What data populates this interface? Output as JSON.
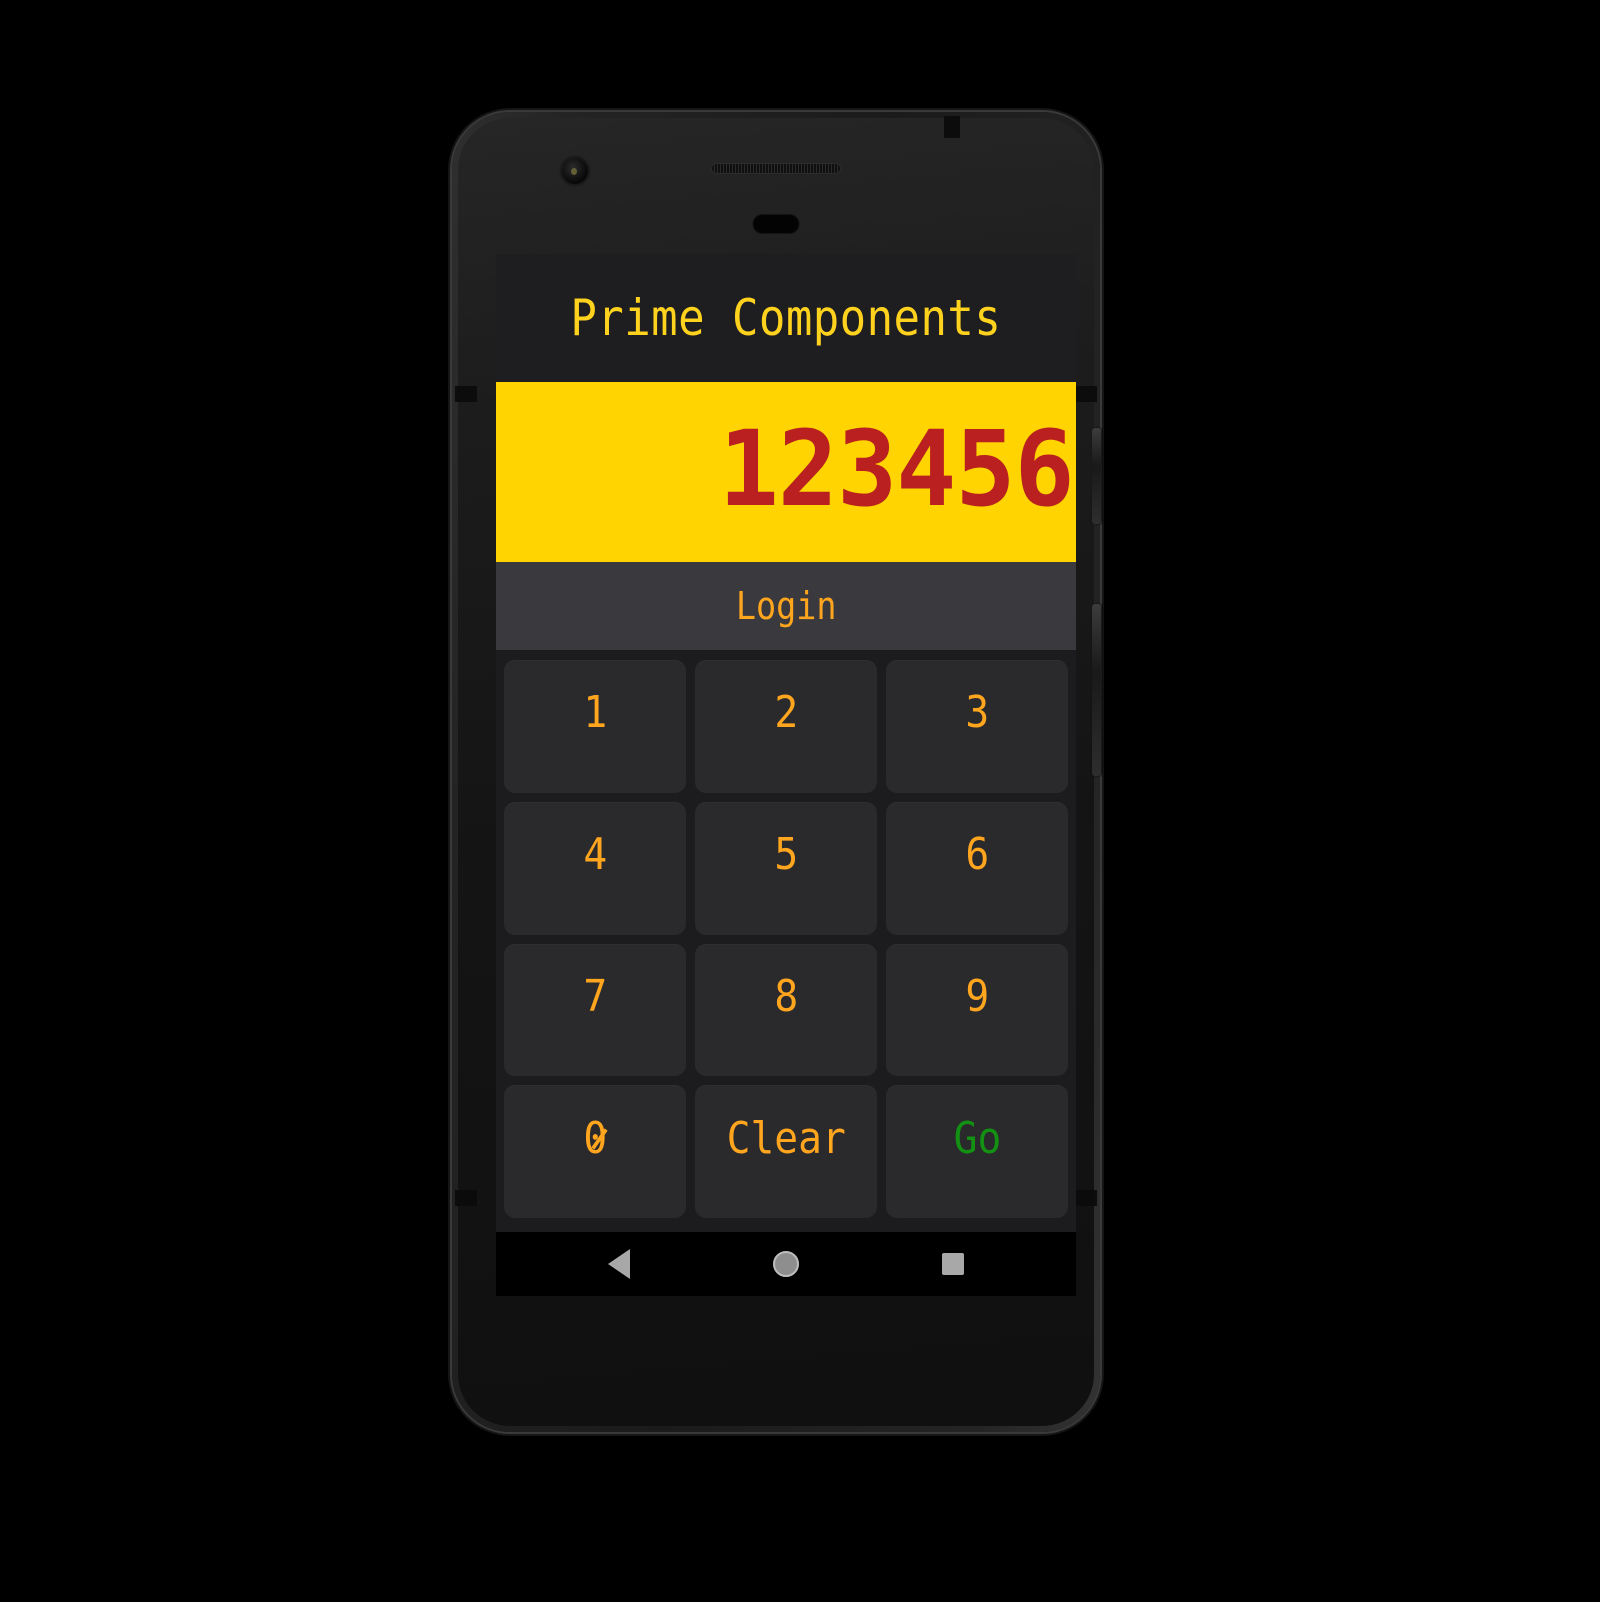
{
  "app": {
    "title": "Prime Components",
    "display_value": "123456",
    "login_label": "Login"
  },
  "keypad": {
    "keys": [
      {
        "label": "1",
        "name": "key-1",
        "kind": "digit"
      },
      {
        "label": "2",
        "name": "key-2",
        "kind": "digit"
      },
      {
        "label": "3",
        "name": "key-3",
        "kind": "digit"
      },
      {
        "label": "4",
        "name": "key-4",
        "kind": "digit"
      },
      {
        "label": "5",
        "name": "key-5",
        "kind": "digit"
      },
      {
        "label": "6",
        "name": "key-6",
        "kind": "digit"
      },
      {
        "label": "7",
        "name": "key-7",
        "kind": "digit"
      },
      {
        "label": "8",
        "name": "key-8",
        "kind": "digit"
      },
      {
        "label": "9",
        "name": "key-9",
        "kind": "digit"
      },
      {
        "label": "0",
        "name": "key-0",
        "kind": "digit-zero"
      },
      {
        "label": "Clear",
        "name": "key-clear",
        "kind": "action"
      },
      {
        "label": "Go",
        "name": "key-go",
        "kind": "action-go"
      }
    ]
  },
  "navbar": {
    "back_icon": "back-triangle-icon",
    "home_icon": "home-circle-icon",
    "recents_icon": "recents-square-icon"
  },
  "device": {
    "camera_icon": "front-camera-icon",
    "earpiece_icon": "earpiece-speaker-icon",
    "sensor_icon": "proximity-sensor-icon",
    "power_key": "power-button",
    "volume_key": "volume-rocker"
  },
  "colors": {
    "accent_yellow": "#ffd21e",
    "display_bg": "#ffd400",
    "display_text": "#b9201f",
    "key_text": "#ffa51e",
    "go_text": "#139113",
    "app_bg": "#1e1e20",
    "keypad_bg": "#1c1c1e",
    "key_bg": "#2a2a2c",
    "login_bg": "#3a3a3e"
  }
}
